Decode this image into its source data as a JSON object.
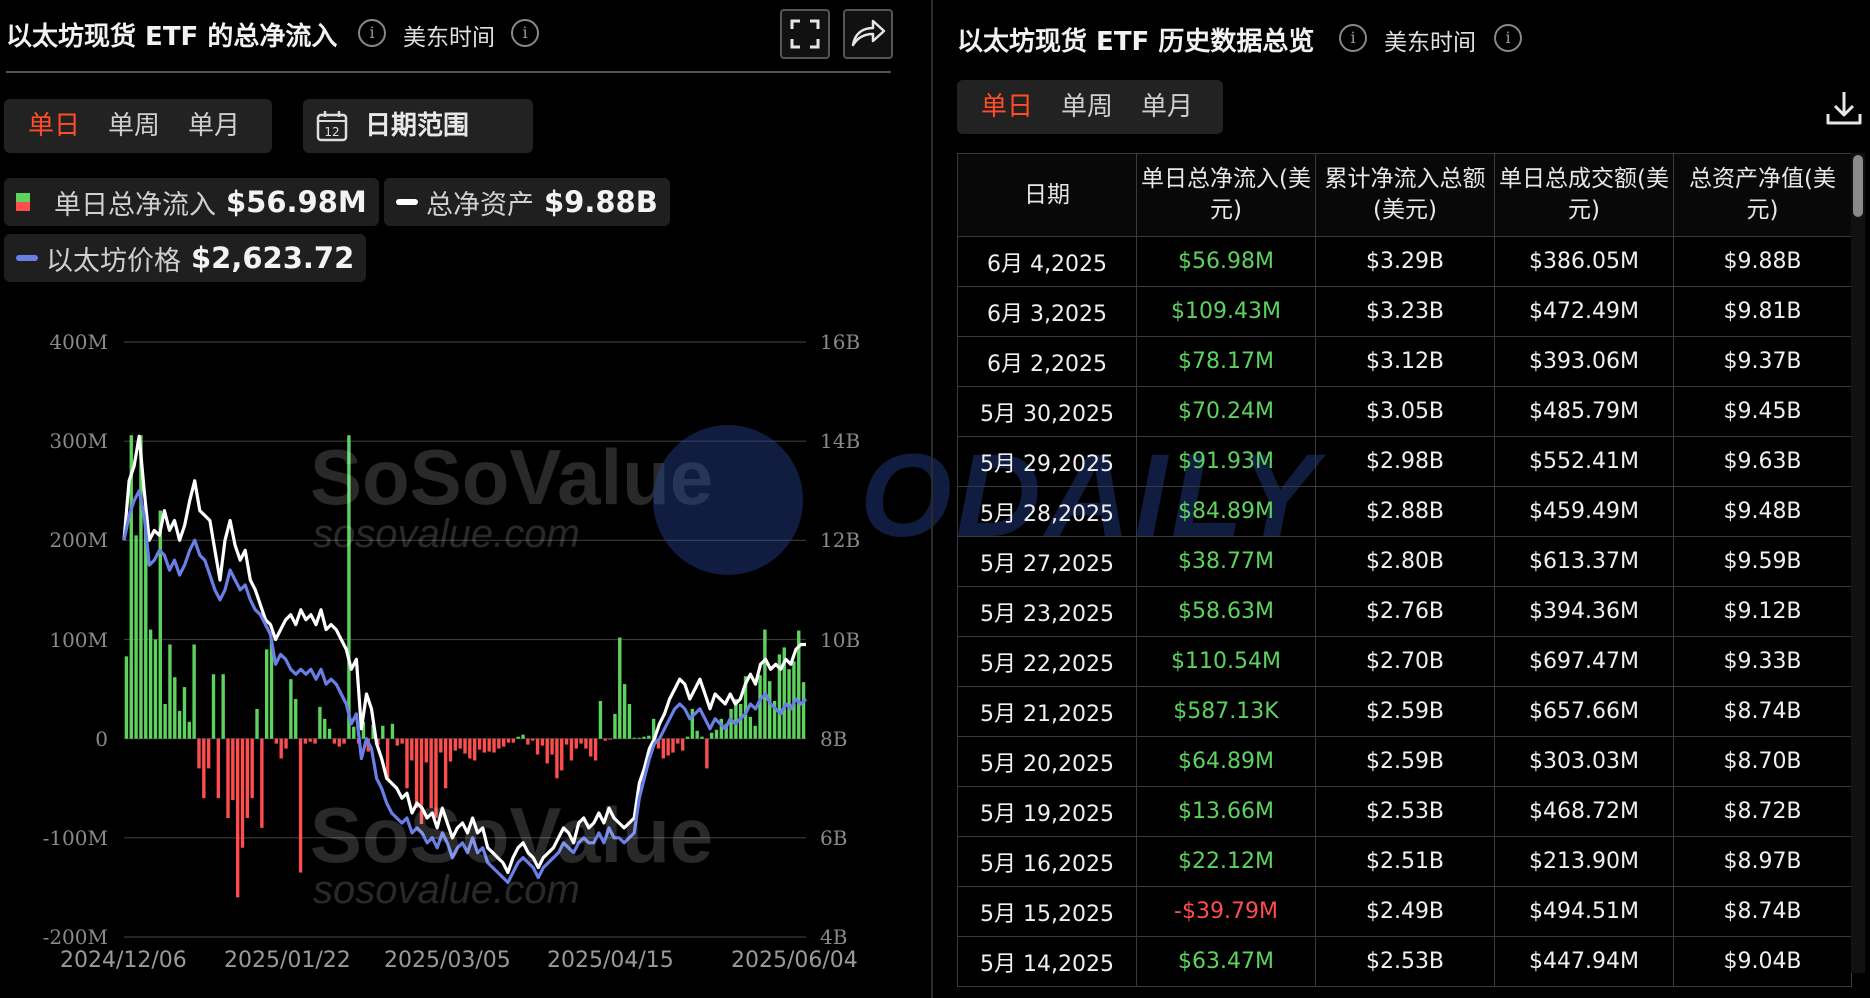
{
  "left": {
    "title": "以太坊现货 ETF 的总净流入",
    "tz_label": "美东时间",
    "info_icon": "i",
    "tabs": [
      "单日",
      "单周",
      "单月"
    ],
    "date_range_label": "日期范围",
    "calendar_icon_text": "12",
    "legend": {
      "inflow_label": "单日总净流入",
      "inflow_value": "$56.98M",
      "assets_label": "总净资产",
      "assets_value": "$9.88B",
      "price_label": "以太坊价格",
      "price_value": "$2,623.72"
    }
  },
  "right": {
    "title": "以太坊现货 ETF 历史数据总览",
    "tz_label": "美东时间",
    "info_icon": "i",
    "tabs": [
      "单日",
      "单周",
      "单月"
    ],
    "columns": [
      "日期",
      "单日总净流入(美元)",
      "累计净流入总额(美元)",
      "单日总成交额(美元)",
      "总资产净值(美元)"
    ],
    "rows": [
      [
        "6月 4,2025",
        "$56.98M",
        "$3.29B",
        "$386.05M",
        "$9.88B"
      ],
      [
        "6月 3,2025",
        "$109.43M",
        "$3.23B",
        "$472.49M",
        "$9.81B"
      ],
      [
        "6月 2,2025",
        "$78.17M",
        "$3.12B",
        "$393.06M",
        "$9.37B"
      ],
      [
        "5月 30,2025",
        "$70.24M",
        "$3.05B",
        "$485.79M",
        "$9.45B"
      ],
      [
        "5月 29,2025",
        "$91.93M",
        "$2.98B",
        "$552.41M",
        "$9.63B"
      ],
      [
        "5月 28,2025",
        "$84.89M",
        "$2.88B",
        "$459.49M",
        "$9.48B"
      ],
      [
        "5月 27,2025",
        "$38.77M",
        "$2.80B",
        "$613.37M",
        "$9.59B"
      ],
      [
        "5月 23,2025",
        "$58.63M",
        "$2.76B",
        "$394.36M",
        "$9.12B"
      ],
      [
        "5月 22,2025",
        "$110.54M",
        "$2.70B",
        "$697.47M",
        "$9.33B"
      ],
      [
        "5月 21,2025",
        "$587.13K",
        "$2.59B",
        "$657.66M",
        "$8.74B"
      ],
      [
        "5月 20,2025",
        "$64.89M",
        "$2.59B",
        "$303.03M",
        "$8.70B"
      ],
      [
        "5月 19,2025",
        "$13.66M",
        "$2.53B",
        "$468.72M",
        "$8.72B"
      ],
      [
        "5月 16,2025",
        "$22.12M",
        "$2.51B",
        "$213.90M",
        "$8.97B"
      ],
      [
        "5月 15,2025",
        "-$39.79M",
        "$2.49B",
        "$494.51M",
        "$8.74B"
      ],
      [
        "5月 14,2025",
        "$63.47M",
        "$2.53B",
        "$447.94M",
        "$9.04B"
      ]
    ]
  },
  "watermarks": {
    "brand": "SoSoValue",
    "url": "sosovalue.com",
    "odaily": "ODAILY"
  },
  "colors": {
    "positive": "#5ed25e",
    "negative": "#ff4d4d",
    "assets_line": "#ffffff",
    "price_line": "#6a7fe6",
    "accent": "#ff4d2a"
  },
  "chart_data": {
    "type": "bar+line",
    "x_tick_labels": [
      "2024/12/06",
      "2025/01/22",
      "2025/03/05",
      "2025/04/15",
      "2025/06/04"
    ],
    "y_left_ticks": [
      "400M",
      "300M",
      "200M",
      "100M",
      "0",
      "-100M",
      "-200M"
    ],
    "y_right_ticks": [
      "16B",
      "14B",
      "12B",
      "10B",
      "8B",
      "6B",
      "4B"
    ],
    "ylim_left": [
      -200,
      400
    ],
    "ylim_right": [
      4,
      16
    ],
    "units_left": "M",
    "units_right": "B",
    "series": [
      {
        "name": "单日总净流入",
        "axis": "left",
        "kind": "bar",
        "values": [
          83,
          306,
          205,
          306,
          230,
          110,
          100,
          230,
          35,
          95,
          62,
          28,
          52,
          17,
          95,
          -30,
          -60,
          -30,
          65,
          -60,
          65,
          -80,
          -62,
          -160,
          -110,
          -80,
          -60,
          30,
          -90,
          90,
          100,
          -5,
          -20,
          -10,
          60,
          40,
          -135,
          -5,
          -3,
          -5,
          32,
          20,
          10,
          -5,
          -8,
          -5,
          306,
          12,
          -5,
          17,
          -13,
          14,
          -6,
          13,
          -42,
          15,
          -7,
          -5,
          -50,
          -22,
          -70,
          -86,
          -24,
          -70,
          -80,
          -14,
          -50,
          -23,
          -12,
          -10,
          -15,
          -20,
          -22,
          -11,
          -14,
          -13,
          -14,
          -10,
          -8,
          -4,
          -4,
          2,
          4,
          -6,
          -2,
          -16,
          -7,
          -25,
          -16,
          -40,
          -32,
          -6,
          -22,
          -10,
          -5,
          -10,
          -18,
          -22,
          38,
          -2,
          -1,
          25,
          102,
          55,
          35,
          1,
          1,
          2,
          3,
          20,
          -10,
          -20,
          -17,
          -14,
          -5,
          -12,
          2,
          30,
          8,
          2,
          -30,
          6,
          9,
          20,
          15,
          30,
          40,
          35,
          63,
          22,
          13,
          64,
          110,
          58,
          38,
          85,
          92,
          70,
          78,
          109,
          57
        ]
      },
      {
        "name": "总净资产",
        "axis": "right",
        "kind": "line",
        "values": [
          12.0,
          13.2,
          13.5,
          14.1,
          13.0,
          12.0,
          12.2,
          12.1,
          12.6,
          12.2,
          12.4,
          12.0,
          12.3,
          12.8,
          13.2,
          12.6,
          12.5,
          12.4,
          11.8,
          11.2,
          12.0,
          12.4,
          11.9,
          11.6,
          11.8,
          11.2,
          11.0,
          10.7,
          10.4,
          10.3,
          10.0,
          10.2,
          10.4,
          10.5,
          10.3,
          10.6,
          10.4,
          10.5,
          10.3,
          10.6,
          10.2,
          10.3,
          10.2,
          10.0,
          9.8,
          9.4,
          9.6,
          8.2,
          8.9,
          8.6,
          7.9,
          7.6,
          7.2,
          7.1,
          7.0,
          6.8,
          6.9,
          6.5,
          6.7,
          6.6,
          6.4,
          6.5,
          6.2,
          6.6,
          6.3,
          6.0,
          6.2,
          6.3,
          6.1,
          6.4,
          6.1,
          6.2,
          5.8,
          5.7,
          5.6,
          5.5,
          5.3,
          5.6,
          5.8,
          5.9,
          5.7,
          5.6,
          5.4,
          5.6,
          5.7,
          5.8,
          6.0,
          6.2,
          6.1,
          5.9,
          6.3,
          6.4,
          6.2,
          6.3,
          6.5,
          6.3,
          6.6,
          6.4,
          6.3,
          6.2,
          6.3,
          6.4,
          7.1,
          7.4,
          7.8,
          8.0,
          8.3,
          8.5,
          8.8,
          9.0,
          9.2,
          9.1,
          8.8,
          9.0,
          9.2,
          8.9,
          8.6,
          8.9,
          8.8,
          8.7,
          8.9,
          8.7,
          8.8,
          9.1,
          9.3,
          9.1,
          9.5,
          9.6,
          9.4,
          9.5,
          9.4,
          9.6,
          9.5,
          9.8,
          9.9,
          9.9
        ]
      },
      {
        "name": "以太坊价格",
        "axis": "right",
        "kind": "line",
        "values": [
          12.0,
          12.5,
          12.8,
          13.0,
          12.5,
          11.5,
          11.6,
          11.8,
          11.7,
          11.4,
          11.6,
          11.3,
          11.5,
          11.8,
          12.0,
          11.7,
          11.6,
          11.3,
          11.0,
          10.8,
          11.0,
          11.4,
          11.2,
          11.0,
          11.1,
          10.8,
          10.6,
          10.5,
          10.3,
          10.1,
          9.5,
          9.7,
          9.6,
          9.4,
          9.3,
          9.4,
          9.3,
          9.4,
          9.2,
          9.4,
          9.1,
          9.2,
          9.1,
          8.9,
          8.7,
          8.3,
          8.5,
          7.6,
          8.0,
          7.8,
          7.2,
          7.0,
          6.7,
          6.5,
          6.4,
          6.3,
          6.4,
          6.1,
          6.2,
          6.1,
          5.9,
          6.0,
          5.8,
          6.1,
          5.9,
          5.6,
          5.8,
          5.9,
          5.7,
          6.0,
          5.7,
          5.8,
          5.5,
          5.4,
          5.3,
          5.2,
          5.1,
          5.3,
          5.5,
          5.6,
          5.5,
          5.4,
          5.2,
          5.4,
          5.5,
          5.6,
          5.7,
          5.9,
          5.8,
          5.7,
          5.9,
          6.0,
          5.9,
          5.9,
          6.1,
          5.9,
          6.2,
          6.0,
          6.0,
          5.9,
          6.0,
          6.1,
          6.8,
          7.2,
          7.6,
          7.9,
          8.0,
          8.2,
          8.4,
          8.6,
          8.7,
          8.6,
          8.4,
          8.5,
          8.6,
          8.4,
          8.2,
          8.4,
          8.3,
          8.2,
          8.4,
          8.3,
          8.4,
          8.5,
          8.7,
          8.6,
          8.8,
          8.9,
          8.7,
          8.6,
          8.5,
          8.7,
          8.6,
          8.8,
          8.7,
          8.8
        ]
      }
    ],
    "grid": true
  }
}
